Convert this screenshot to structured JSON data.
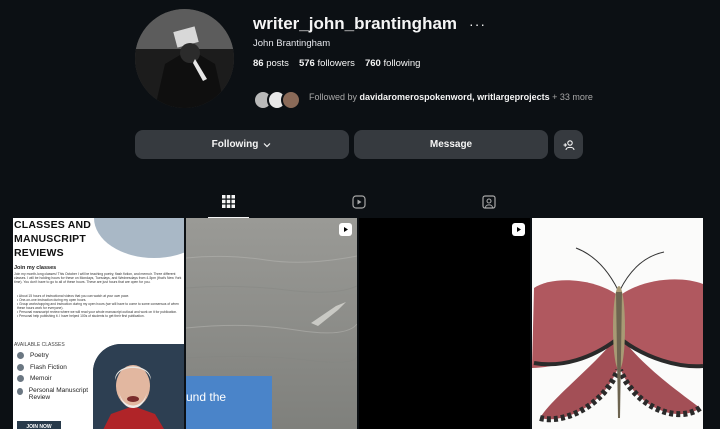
{
  "profile": {
    "username": "writer_john_brantingham",
    "full_name": "John Brantingham",
    "posts_count": "86",
    "posts_label": "posts",
    "followers_count": "576",
    "followers_label": "followers",
    "following_count": "760",
    "following_label": "following",
    "followed_by_prefix": "Followed by",
    "followed_by_names": "davidaromerospokenword, writlargeprojects",
    "followed_by_more": "+ 33 more"
  },
  "actions": {
    "following_label": "Following",
    "message_label": "Message"
  },
  "tabs": [
    {
      "name": "posts",
      "icon": "grid-icon",
      "active": true
    },
    {
      "name": "reels",
      "icon": "reels-icon",
      "active": false
    },
    {
      "name": "tagged",
      "icon": "tagged-icon",
      "active": false
    }
  ],
  "grid": {
    "post1": {
      "title": "CLASSES AND MANUSCRIPT REVIEWS",
      "join_heading": "Join my classes",
      "paragraph": "Join my month-long classes! This October I will be teaching poetry, flash fiction, and memoir. Three different classes. I will be holding hours for these on Mondays, Tuesdays, and Wednesdays from 4-5pm (that's New York time). You don't have to go to all of these hours. These are just hours that are open for you.",
      "bullets": [
        "About 15 hours of instructional videos that you can watch at your own pace.",
        "One-on-one instruction during my open hours.",
        "Group workshopping and instruction during my open hours (we will have to come to some consensus of when these hours work for everyone).",
        "Personal manuscript review where we will read your whole manuscript outloud and work on it for publication.",
        "Personal help publishing it. I have helped 100s of students to get their first publication."
      ],
      "available_label": "AVAILABLE CLASSES",
      "classes": [
        "Poetry",
        "Flash Fiction",
        "Memoir",
        "Personal Manuscript Review"
      ],
      "join_button": "JOIN NOW"
    },
    "post2": {
      "card_text": "und the",
      "type": "reel"
    },
    "post3": {
      "type": "reel"
    },
    "post4": {
      "type": "image"
    }
  },
  "colors": {
    "background": "#0c1014",
    "button": "#363a3f",
    "text": "#f5f5f5",
    "muted": "#a8a8a8"
  }
}
